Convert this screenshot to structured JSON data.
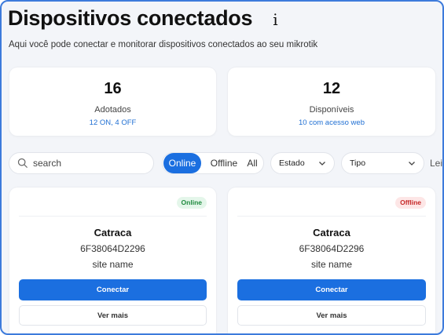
{
  "header": {
    "title": "Dispositivos conectados",
    "info_icon": "info-icon",
    "info_glyph": "i",
    "subtitle": "Aqui você pode conectar e monitorar dispositivos conectados ao seu mikrotik"
  },
  "stats": [
    {
      "value": "16",
      "label": "Adotados",
      "sub": "12 ON, 4 OFF"
    },
    {
      "value": "12",
      "label": "Disponíveis",
      "sub": "10 com acesso web"
    }
  ],
  "filters": {
    "search_placeholder": "search",
    "segments": [
      "Online",
      "Offline",
      "All"
    ],
    "selected_segment": "Online",
    "estado_label": "Estado",
    "tipo_label": "Tipo",
    "clipped_label": "Leit"
  },
  "devices": [
    {
      "status": "Online",
      "name": "Catraca",
      "serial": "6F38064D2296",
      "site": "site name",
      "connect_label": "Conectar",
      "more_label": "Ver mais"
    },
    {
      "status": "Offline",
      "name": "Catraca",
      "serial": "6F38064D2296",
      "site": "site name",
      "connect_label": "Conectar",
      "more_label": "Ver mais"
    }
  ],
  "colors": {
    "accent": "#1b6fe0",
    "online_badge": "#1f8a3e",
    "offline_badge": "#c62828",
    "frame_border": "#3d7bdc"
  }
}
